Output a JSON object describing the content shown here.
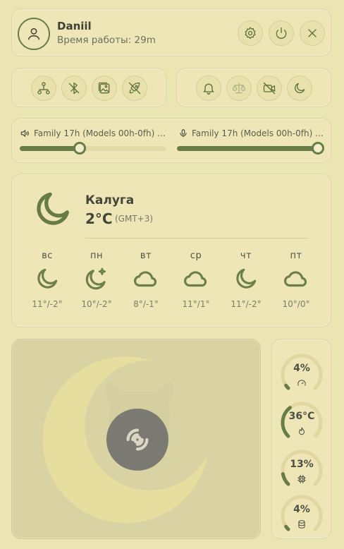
{
  "profile": {
    "name": "Daniil",
    "uptime": "Время работы: 29m"
  },
  "header_buttons": [
    "settings-icon",
    "power-icon",
    "close-icon"
  ],
  "quick_toggles_left": [
    "network-icon",
    "bluetooth-off-icon",
    "image-icon",
    "rocket-off-icon"
  ],
  "quick_toggles_right": [
    "bell-icon",
    "scale-icon",
    "camera-off-icon",
    "moon-icon"
  ],
  "audio": {
    "output": {
      "label": "Family 17h (Models 00h-0fh) ...",
      "level": 0.41
    },
    "input": {
      "label": "Family 17h (Models 00h-0fh) ...",
      "level": 1.0
    }
  },
  "weather": {
    "city": "Калуга",
    "temp": "2°C",
    "tz": "(GMT+3)",
    "icon": "moon-icon",
    "days": [
      {
        "name": "вс",
        "icon": "moon-icon",
        "temps": "11°/-2°"
      },
      {
        "name": "пн",
        "icon": "moon-stars-icon",
        "temps": "10°/-2°"
      },
      {
        "name": "вт",
        "icon": "cloud-icon",
        "temps": "8°/-1°"
      },
      {
        "name": "ср",
        "icon": "cloud-icon",
        "temps": "11°/1°"
      },
      {
        "name": "чт",
        "icon": "moon-icon",
        "temps": "11°/-2°"
      },
      {
        "name": "пт",
        "icon": "cloud-icon",
        "temps": "10°/0°"
      }
    ]
  },
  "media": {
    "icon": "disc-icon"
  },
  "stats": [
    {
      "value": "4%",
      "level": 0.04,
      "icon": "speedometer-icon"
    },
    {
      "value": "36°C",
      "level": 0.36,
      "icon": "flame-icon"
    },
    {
      "value": "13%",
      "level": 0.13,
      "icon": "cpu-icon"
    },
    {
      "value": "4%",
      "level": 0.04,
      "icon": "database-icon"
    }
  ],
  "colors": {
    "accent": "#667d45",
    "background": "#ebe4b3",
    "card": "#eee6b6"
  }
}
